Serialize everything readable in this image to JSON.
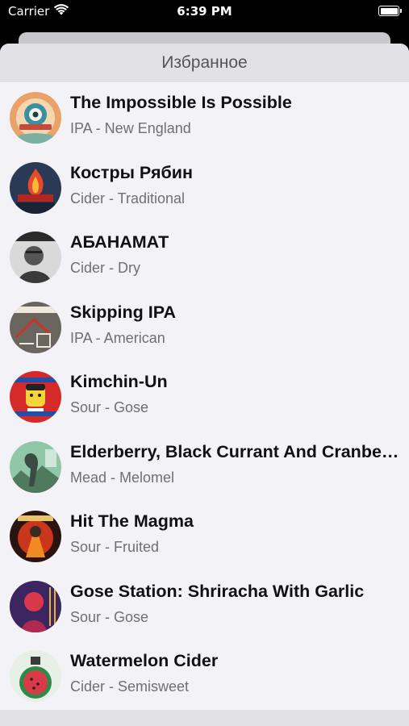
{
  "status_bar": {
    "carrier": "Carrier",
    "time": "6:39 PM"
  },
  "sheet": {
    "title": "Избранное"
  },
  "favorites": [
    {
      "name": "The Impossible Is Possible",
      "style": "IPA - New England"
    },
    {
      "name": "Костры Рябин",
      "style": "Cider - Traditional"
    },
    {
      "name": "АБАНАМАТ",
      "style": "Cider - Dry"
    },
    {
      "name": "Skipping IPA",
      "style": "IPA - American"
    },
    {
      "name": "Kimchin-Un",
      "style": "Sour - Gose"
    },
    {
      "name": "Elderberry, Black Currant And Cranberry",
      "style": "Mead - Melomel"
    },
    {
      "name": "Hit The Magma",
      "style": "Sour - Fruited"
    },
    {
      "name": "Gose Station: Shriracha With Garlic",
      "style": "Sour - Gose"
    },
    {
      "name": "Watermelon Cider",
      "style": "Cider - Semisweet"
    }
  ]
}
